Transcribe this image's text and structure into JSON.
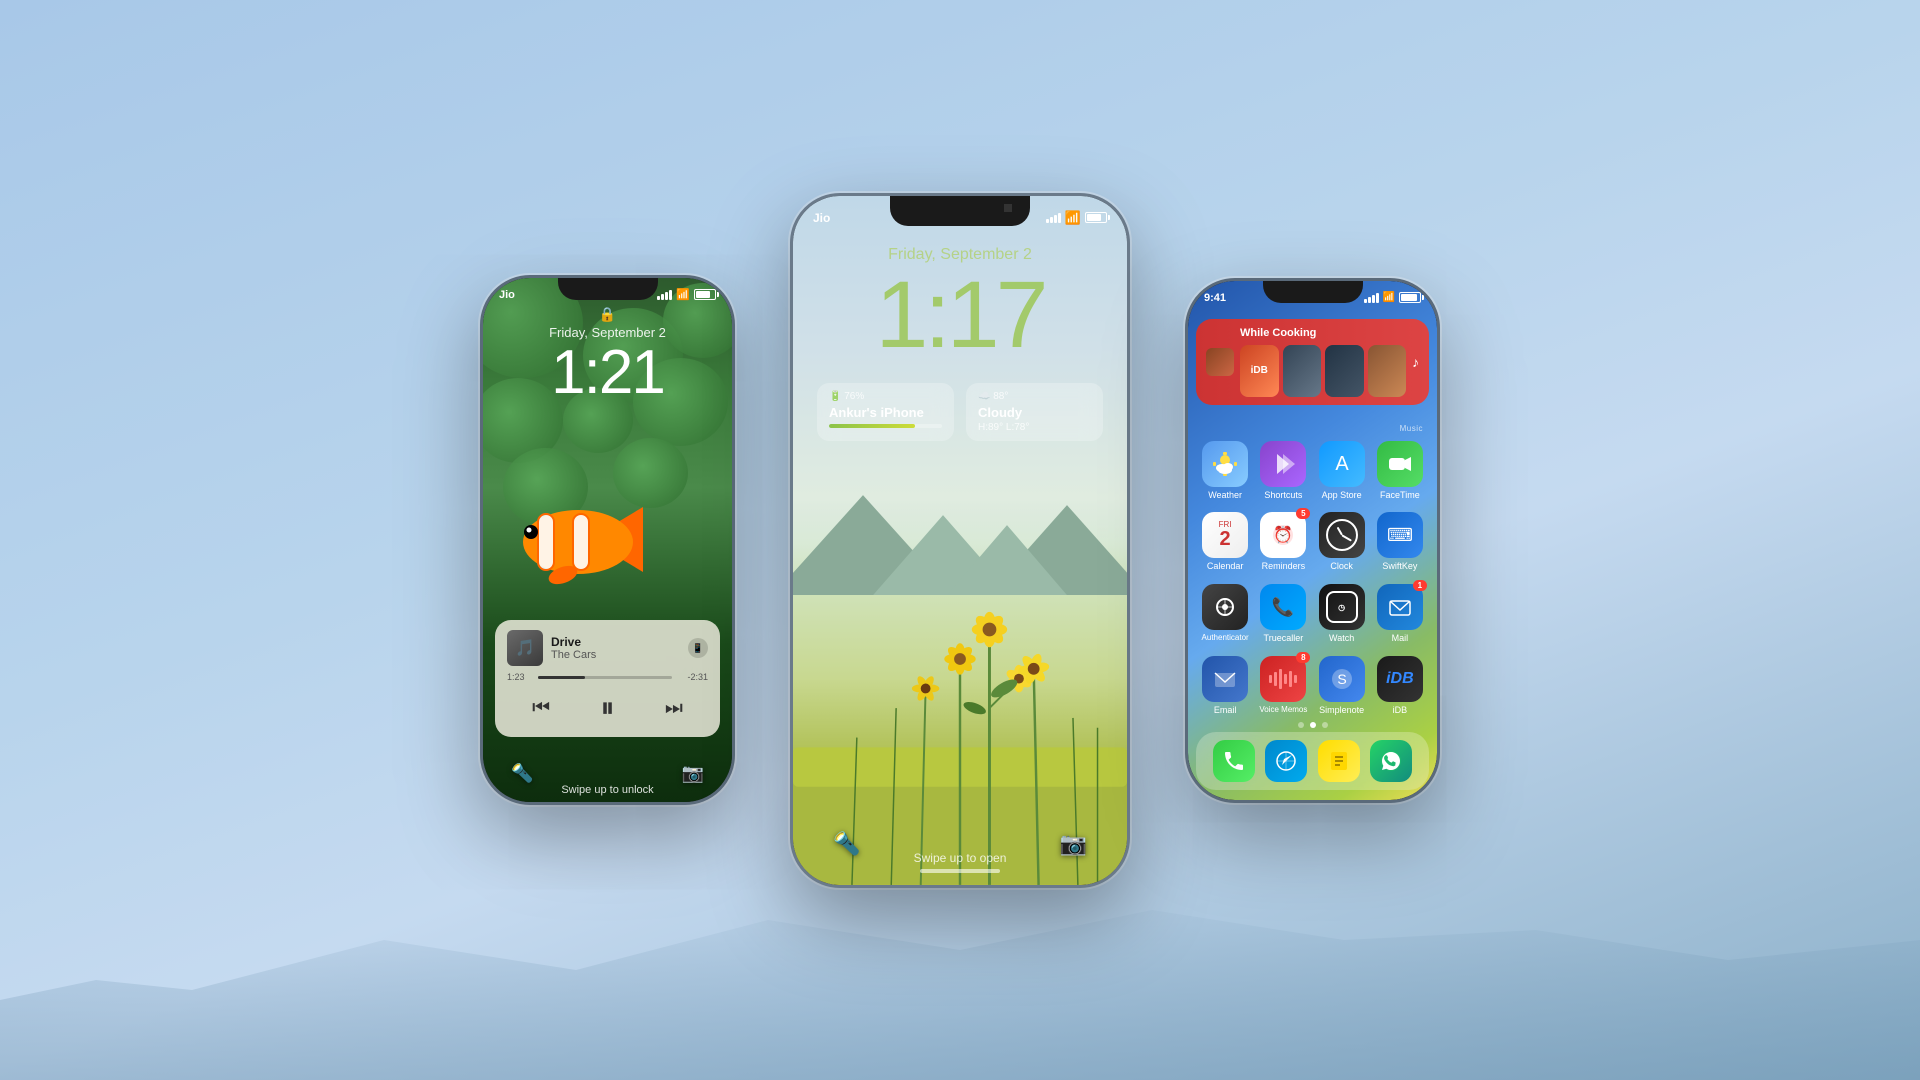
{
  "background": {
    "gradient_start": "#a8c8e8",
    "gradient_end": "#8bafc8"
  },
  "phones": {
    "left": {
      "carrier": "Jio",
      "date": "Friday, September 2",
      "time": "1:21",
      "music": {
        "title": "Drive",
        "artist": "The Cars",
        "elapsed": "1:23",
        "remaining": "-2:31"
      },
      "swipe_hint": "Swipe up to unlock"
    },
    "center": {
      "carrier": "Jio",
      "date": "Friday, September 2",
      "time": "1:17",
      "battery_percent": "76%",
      "battery_device": "Ankur's iPhone",
      "weather_temp": "88°",
      "weather_condition": "Cloudy",
      "weather_high_low": "H:89° L:78°",
      "swipe_hint": "Swipe up to open"
    },
    "right": {
      "time": "9:41",
      "music_banner": "While Cooking",
      "music_section_label": "Music",
      "apps_row1": [
        {
          "id": "weather",
          "label": "Weather"
        },
        {
          "id": "shortcuts",
          "label": "Shortcuts"
        },
        {
          "id": "appstore",
          "label": "App Store"
        },
        {
          "id": "facetime",
          "label": "FaceTime"
        }
      ],
      "apps_row2": [
        {
          "id": "calendar",
          "label": "Calendar",
          "day": "2",
          "month": "FRI"
        },
        {
          "id": "reminders",
          "label": "Reminders",
          "badge": "5"
        },
        {
          "id": "clock",
          "label": "Clock"
        },
        {
          "id": "swiftkey",
          "label": "SwiftKey"
        }
      ],
      "apps_row3": [
        {
          "id": "auth",
          "label": "Authenticator"
        },
        {
          "id": "truecaller",
          "label": "Truecaller"
        },
        {
          "id": "watch",
          "label": "Watch"
        },
        {
          "id": "mail",
          "label": "Mail",
          "badge": "1"
        }
      ],
      "apps_row4": [
        {
          "id": "email",
          "label": "Email"
        },
        {
          "id": "voicememos",
          "label": "Voice Memos",
          "badge": "8"
        },
        {
          "id": "simplenote",
          "label": "Simplenote"
        },
        {
          "id": "idb",
          "label": "iDB"
        }
      ],
      "dock": [
        {
          "id": "phone",
          "label": "Phone"
        },
        {
          "id": "safari",
          "label": "Safari"
        },
        {
          "id": "notes",
          "label": "Notes"
        },
        {
          "id": "whatsapp",
          "label": "WhatsApp"
        }
      ]
    }
  }
}
